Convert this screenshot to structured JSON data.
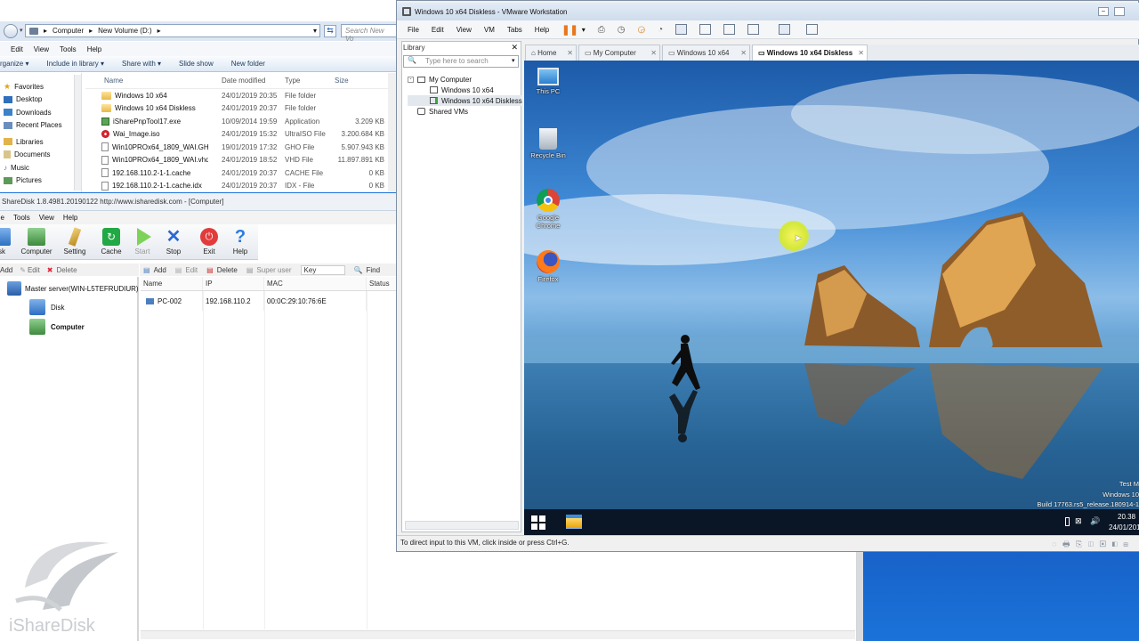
{
  "explorer": {
    "breadcrumb": [
      "Computer",
      "New Volume (D:)"
    ],
    "search_placeholder": "Search New Vo",
    "menu": [
      "Edit",
      "View",
      "Tools",
      "Help"
    ],
    "commands": [
      "rganize ▾",
      "Include in library ▾",
      "Share with ▾",
      "Slide show",
      "New folder"
    ],
    "nav": [
      {
        "label": "Favorites",
        "icon": "star-icon"
      },
      {
        "label": "Desktop",
        "icon": "desktop-icon"
      },
      {
        "label": "Downloads",
        "icon": "downloads-icon"
      },
      {
        "label": "Recent Places",
        "icon": "recent-places-icon"
      },
      {
        "label": "Libraries",
        "icon": "libraries-icon"
      },
      {
        "label": "Documents",
        "icon": "documents-icon"
      },
      {
        "label": "Music",
        "icon": "music-icon"
      },
      {
        "label": "Pictures",
        "icon": "pictures-icon"
      }
    ],
    "columns": [
      "Name",
      "Date modified",
      "Type",
      "Size"
    ],
    "files": [
      {
        "name": "Windows 10 x64",
        "date": "24/01/2019 20:35",
        "type": "File folder",
        "size": "",
        "icon": "folder-icon"
      },
      {
        "name": "Windows 10 x64 Diskless",
        "date": "24/01/2019 20:37",
        "type": "File folder",
        "size": "",
        "icon": "folder-icon"
      },
      {
        "name": "iSharePnpTool17.exe",
        "date": "10/09/2014 19:59",
        "type": "Application",
        "size": "3.209 KB",
        "icon": "app-icon"
      },
      {
        "name": "Wai_Image.iso",
        "date": "24/01/2019 15:32",
        "type": "UltraISO File",
        "size": "3.200.684 KB",
        "icon": "iso-icon"
      },
      {
        "name": "Win10PROx64_1809_WAI.GHO",
        "date": "19/01/2019 17:32",
        "type": "GHO File",
        "size": "5.907.943 KB",
        "icon": "file-icon"
      },
      {
        "name": "Win10PROx64_1809_WAI.vhd",
        "date": "24/01/2019 18:52",
        "type": "VHD File",
        "size": "11.897.891 KB",
        "icon": "file-icon"
      },
      {
        "name": "192.168.110.2-1-1.cache",
        "date": "24/01/2019 20:37",
        "type": "CACHE File",
        "size": "0 KB",
        "icon": "file-icon"
      },
      {
        "name": "192.168.110.2-1-1.cache.idx",
        "date": "24/01/2019 20:37",
        "type": "IDX - File",
        "size": "0 KB",
        "icon": "file-icon"
      }
    ]
  },
  "isharedisk": {
    "title": "ShareDisk 1.8.4981.20190122 http://www.isharedisk.com - [Computer]",
    "menu": [
      "ile",
      "Tools",
      "View",
      "Help"
    ],
    "toolbar": [
      {
        "label": "sk",
        "icon": "disk-icon"
      },
      {
        "label": "Computer",
        "icon": "computer-icon"
      },
      {
        "label": "Setting",
        "icon": "setting-icon"
      },
      {
        "label": "Cache",
        "icon": "cache-icon"
      },
      {
        "label": "Start",
        "icon": "start-icon"
      },
      {
        "label": "Stop",
        "icon": "stop-icon"
      },
      {
        "label": "Exit",
        "icon": "exit-icon"
      },
      {
        "label": "Help",
        "icon": "help-icon"
      }
    ],
    "left_actions": [
      "Add",
      "Edit",
      "Delete"
    ],
    "right_actions": [
      "Add",
      "Edit",
      "Delete",
      "Super user"
    ],
    "key_placeholder": "Key",
    "find_label": "Find",
    "tree": {
      "root": "Master server(WIN-L5TEFRUDIUR)",
      "children": [
        "Disk",
        "Computer"
      ]
    },
    "grid_columns": [
      "Name",
      "IP",
      "MAC",
      "Status"
    ],
    "grid_rows": [
      {
        "name": "PC-002",
        "ip": "192.168.110.2",
        "mac": "00:0C:29:10:76:6E",
        "status": ""
      }
    ],
    "logo_text": "iShareDisk"
  },
  "vmware": {
    "title": "Windows 10 x64 Diskless - VMware Workstation",
    "menu": [
      "File",
      "Edit",
      "View",
      "VM",
      "Tabs",
      "Help"
    ],
    "library": {
      "title": "Library",
      "search_placeholder": "Type here to search",
      "tree": [
        "My Computer",
        "Windows 10 x64",
        "Windows 10 x64 Diskless",
        "Shared VMs"
      ]
    },
    "tabs": [
      "Home",
      "My Computer",
      "Windows 10 x64",
      "Windows 10 x64 Diskless"
    ],
    "status_text": "To direct input to this VM, click inside or press Ctrl+G.",
    "desktop_icons": [
      {
        "label": "This PC",
        "icon": "this-pc-icon"
      },
      {
        "label": "Recycle Bin",
        "icon": "recycle-bin-icon"
      },
      {
        "label": "Google Chrome",
        "icon": "chrome-icon"
      },
      {
        "label": "Firefox",
        "icon": "firefox-icon"
      }
    ],
    "watermark": [
      "Test M",
      "Windows 10",
      "Build 17763.rs5_release.180914-1"
    ],
    "clock_time": "20.38",
    "clock_date": "24/01/201"
  }
}
